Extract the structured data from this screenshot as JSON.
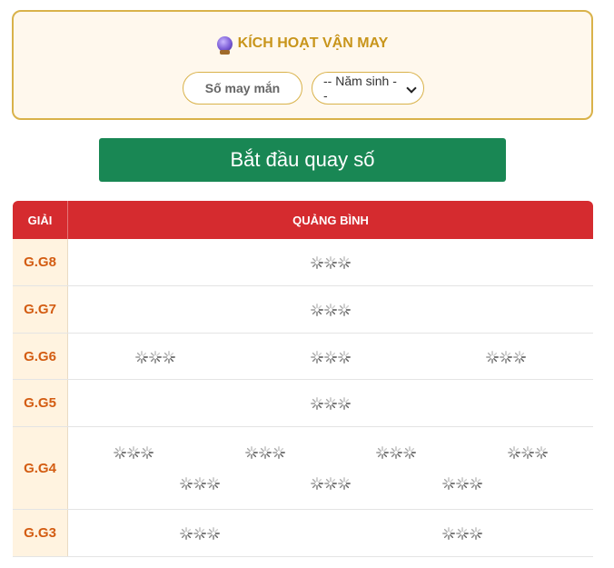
{
  "activate": {
    "title": "KÍCH HOẠT VẬN MAY",
    "lucky_number_placeholder": "Số may mắn",
    "birth_year_selected": "-- Năm sinh --"
  },
  "start_button_label": "Bắt đầu quay số",
  "table": {
    "prize_header": "GIẢI",
    "province_header": "QUẢNG BÌNH",
    "rows": [
      {
        "prize": "G.G8",
        "slots": 1
      },
      {
        "prize": "G.G7",
        "slots": 1
      },
      {
        "prize": "G.G6",
        "slots": 3
      },
      {
        "prize": "G.G5",
        "slots": 1
      },
      {
        "prize": "G.G4",
        "slots": 7
      },
      {
        "prize": "G.G3",
        "slots": 2
      }
    ]
  },
  "colors": {
    "accent_gold": "#c8951b",
    "start_green": "#198754",
    "header_red": "#d52b2f",
    "prize_orange": "#d35c12"
  },
  "icons": [
    "crystal-ball-icon",
    "chevron-down-icon",
    "spinner-icon"
  ]
}
